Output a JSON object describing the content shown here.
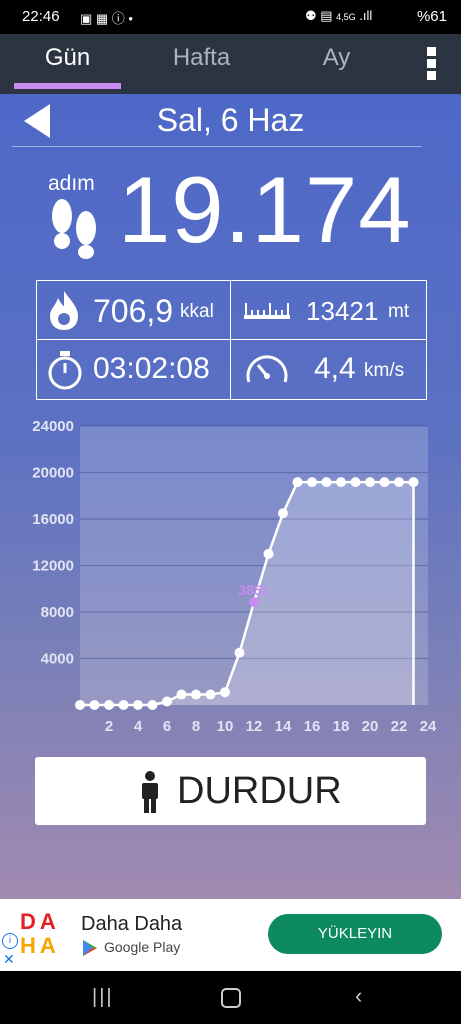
{
  "status_bar": {
    "time": "22:46",
    "battery": "%61",
    "network": "4,5G"
  },
  "tabs": [
    {
      "label": "Gün"
    },
    {
      "label": "Hafta"
    },
    {
      "label": "Ay"
    }
  ],
  "date": "Sal, 6 Haz",
  "steps": {
    "label": "adım",
    "value": "19.174"
  },
  "stats": {
    "calories": {
      "value": "706,9",
      "unit": "kkal"
    },
    "distance": {
      "value": "13421",
      "unit": "mt"
    },
    "duration": {
      "value": "03:02:08"
    },
    "speed": {
      "value": "4,4",
      "unit": "km/s"
    }
  },
  "chart_data": {
    "type": "line",
    "x": [
      0,
      1,
      2,
      3,
      4,
      5,
      6,
      7,
      8,
      9,
      10,
      11,
      12,
      13,
      14,
      15,
      16,
      17,
      18,
      19,
      20,
      21,
      22,
      23
    ],
    "y": [
      0,
      0,
      0,
      0,
      0,
      0,
      300,
      900,
      900,
      900,
      1100,
      4500,
      8850,
      13000,
      16500,
      19174,
      19174,
      19174,
      19174,
      19174,
      19174,
      19174,
      19174,
      19174
    ],
    "highlight": {
      "x": 12,
      "label": "3851"
    },
    "xticks": [
      "2",
      "4",
      "6",
      "8",
      "10",
      "12",
      "14",
      "16",
      "18",
      "20",
      "22",
      "24"
    ],
    "yticks": [
      "4000",
      "8000",
      "12000",
      "16000",
      "20000",
      "24000"
    ],
    "xlim": [
      0,
      24
    ],
    "ylim": [
      0,
      24000
    ],
    "grid": true,
    "colors": {
      "line": "#ffffff",
      "highlight": "#c78cf0",
      "tick": "#e0e4f4"
    }
  },
  "stop_button": {
    "label": "DURDUR"
  },
  "ad": {
    "logo_top": "DA",
    "logo_bottom": "HA",
    "title": "Daha Daha",
    "store": "Google Play",
    "cta": "YÜKLEYIN"
  }
}
